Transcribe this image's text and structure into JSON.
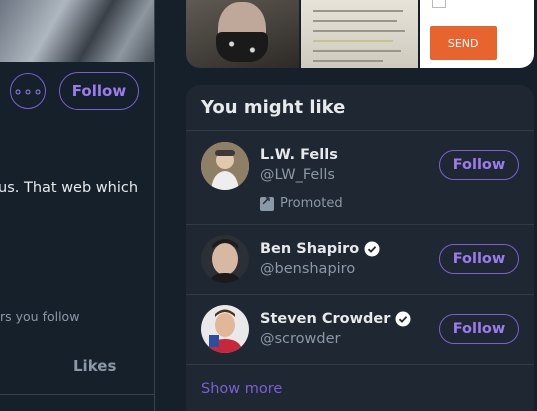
{
  "left": {
    "more_glyph": "∘∘∘",
    "follow_label": "Follow",
    "bio_fragment": "us. That web which",
    "followers_fragment": "rs you follow",
    "tab_likes": "Likes"
  },
  "media": {
    "send_label": "SEND"
  },
  "suggestions": {
    "title": "You might like",
    "items": [
      {
        "name": "L.W. Fells",
        "handle": "@LW_Fells",
        "verified": false,
        "promoted": "Promoted",
        "follow_label": "Follow"
      },
      {
        "name": "Ben Shapiro",
        "handle": "@benshapiro",
        "verified": true,
        "follow_label": "Follow"
      },
      {
        "name": "Steven Crowder",
        "handle": "@scrowder",
        "verified": true,
        "follow_label": "Follow"
      }
    ],
    "show_more": "Show more"
  },
  "colors": {
    "background": "#15202b",
    "card": "#1e2732",
    "accent": "#7b5fd6",
    "muted_text": "#8b98a5"
  }
}
